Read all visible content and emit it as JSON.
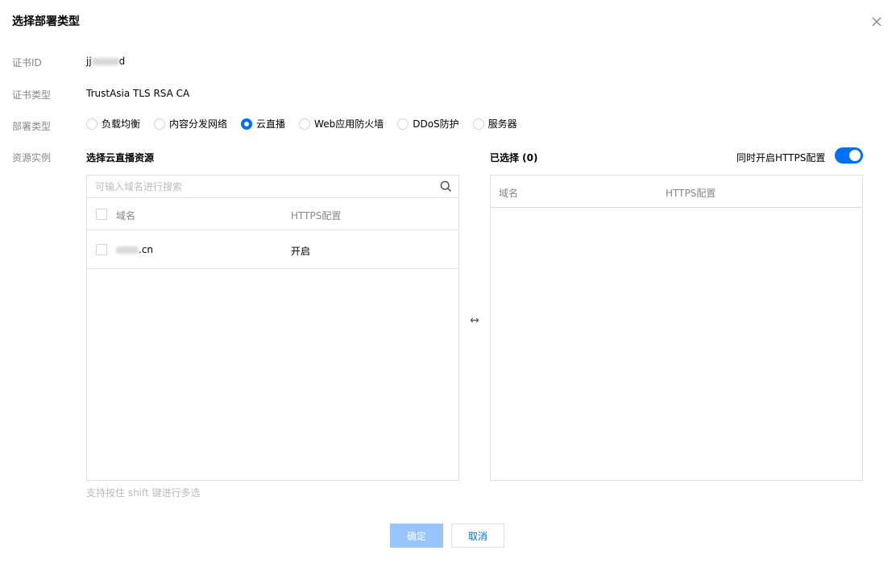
{
  "dialog": {
    "title": "选择部署类型"
  },
  "form": {
    "cert_id": {
      "label": "证书ID",
      "value_prefix": "jj",
      "value_suffix": "d"
    },
    "cert_type": {
      "label": "证书类型",
      "value": "TrustAsia TLS RSA CA"
    },
    "deploy_type": {
      "label": "部署类型",
      "options": [
        {
          "label": "负载均衡",
          "checked": false
        },
        {
          "label": "内容分发网络",
          "checked": false
        },
        {
          "label": "云直播",
          "checked": true
        },
        {
          "label": "Web应用防火墙",
          "checked": false
        },
        {
          "label": "DDoS防护",
          "checked": false
        },
        {
          "label": "服务器",
          "checked": false
        }
      ]
    },
    "resource": {
      "label": "资源实例"
    }
  },
  "left_panel": {
    "title": "选择云直播资源",
    "search_placeholder": "可输入域名进行搜索",
    "columns": [
      "域名",
      "HTTPS配置"
    ],
    "rows": [
      {
        "domain_suffix": ".cn",
        "https": "开启"
      }
    ]
  },
  "right_panel": {
    "title": "已选择 (0)",
    "toggle_label": "同时开启HTTPS配置",
    "toggle_on": true,
    "columns": [
      "域名",
      "HTTPS配置"
    ]
  },
  "transfer_icon": "↔",
  "hint": "支持按住 shift 键进行多选",
  "footer": {
    "ok_label": "确定",
    "cancel_label": "取消"
  },
  "colors": {
    "primary": "#006eff",
    "ok_disabled": "#99c5ff"
  }
}
